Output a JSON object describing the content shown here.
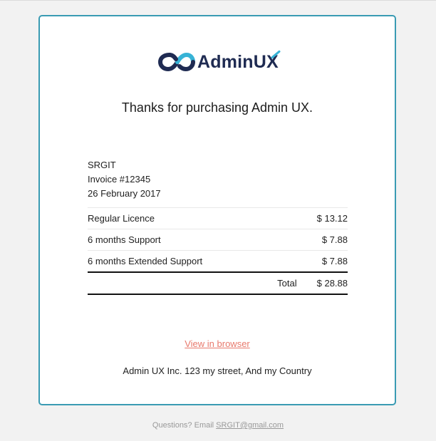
{
  "brand": {
    "logo_icon": "adminux-infinity-logo-icon",
    "name_main": "AdminU",
    "name_last": "X",
    "colors": {
      "navy": "#1f2b52",
      "cyan": "#37b3d6",
      "card_border": "#3a9bb3",
      "link": "#e8796c"
    }
  },
  "headline": "Thanks for purchasing Admin UX.",
  "invoice": {
    "company": "SRGIT",
    "number": "Invoice #12345",
    "date": "26 February 2017",
    "items": [
      {
        "name": "Regular Licence",
        "price": "$ 13.12"
      },
      {
        "name": "6 months Support",
        "price": "$ 7.88"
      },
      {
        "name": "6 months Extended Support",
        "price": "$ 7.88"
      }
    ],
    "total_label": "Total",
    "total_value": "$ 28.88"
  },
  "view_in_browser": "View in browser",
  "address": "Admin UX Inc. 123 my street, And my Country",
  "footer": {
    "prefix": "Questions? Email ",
    "email": "SRGIT@gmail.com"
  }
}
